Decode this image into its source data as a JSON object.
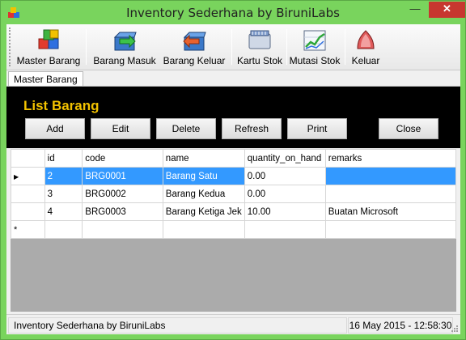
{
  "window": {
    "title": "Inventory Sederhana by BiruniLabs",
    "minimize": "—",
    "maximize": "❐",
    "close": "✕"
  },
  "toolbar": {
    "items": [
      {
        "label": "Master Barang",
        "icon": "cubes-icon"
      },
      {
        "label": "Barang Masuk",
        "icon": "box-in-icon"
      },
      {
        "label": "Barang Keluar",
        "icon": "box-out-icon"
      },
      {
        "label": "Kartu Stok",
        "icon": "card-icon"
      },
      {
        "label": "Mutasi Stok",
        "icon": "chart-icon"
      },
      {
        "label": "Keluar",
        "icon": "exit-icon"
      }
    ]
  },
  "tabs": [
    {
      "label": "Master Barang"
    }
  ],
  "panel": {
    "title": "List Barang",
    "buttons": {
      "add": "Add",
      "edit": "Edit",
      "delete": "Delete",
      "refresh": "Refresh",
      "print": "Print",
      "close": "Close"
    }
  },
  "grid": {
    "columns": [
      "id",
      "code",
      "name",
      "quantity_on_hand",
      "remarks"
    ],
    "rows": [
      {
        "id": "2",
        "code": "BRG0001",
        "name": "Barang Satu",
        "qty": "0.00",
        "remarks": ""
      },
      {
        "id": "3",
        "code": "BRG0002",
        "name": "Barang Kedua",
        "qty": "0.00",
        "remarks": ""
      },
      {
        "id": "4",
        "code": "BRG0003",
        "name": "Barang Ketiga Jek",
        "qty": "10.00",
        "remarks": "Buatan Microsoft"
      }
    ],
    "selected_row_marker": "▶",
    "new_row_marker": "*"
  },
  "status": {
    "left": "Inventory Sederhana by BiruniLabs",
    "right": "16 May 2015 - 12:58:30"
  },
  "colors": {
    "titlebar": "#79d45d",
    "panel": "#000000",
    "panel_title": "#f2c200",
    "selection": "#3399ff"
  }
}
